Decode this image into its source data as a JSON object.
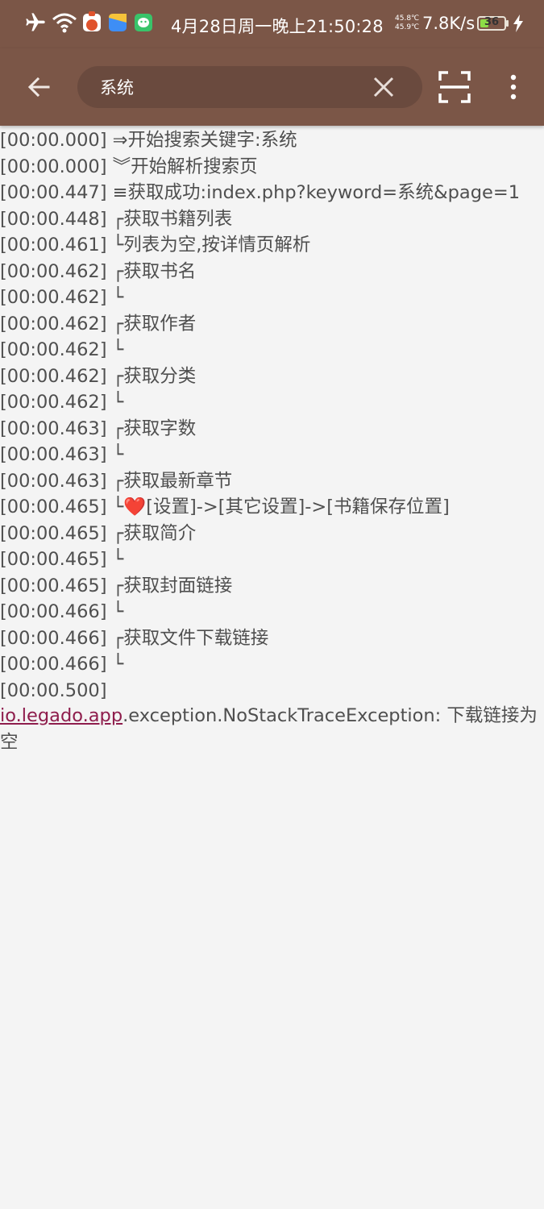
{
  "status_bar": {
    "time": "4月28日周一晚上21:50:28",
    "temp_top": "45.8℃",
    "temp_bottom": "45.9℃",
    "net_speed": "7.8K/s",
    "battery": "36",
    "battery_level": 0.36,
    "icons": [
      "airplane-icon",
      "wifi-icon",
      "app-notification-icon",
      "app-notification-icon",
      "app-notification-icon",
      "charging-icon"
    ]
  },
  "toolbar": {
    "search_value": "系统",
    "colors": {
      "bar": "#7b5647",
      "search_bg": "#6a4a3e"
    }
  },
  "log": {
    "lines": [
      {
        "ts": "[00:00.000]",
        "msg": "⇒开始搜索关键字:系统"
      },
      {
        "ts": "[00:00.000]",
        "msg": "︾开始解析搜索页"
      },
      {
        "ts": "[00:00.447]",
        "msg": "≡获取成功:index.php?keyword=系统&page=1"
      },
      {
        "ts": "[00:00.448]",
        "msg": "┌获取书籍列表"
      },
      {
        "ts": "[00:00.461]",
        "msg": "└列表为空,按详情页解析"
      },
      {
        "ts": "[00:00.462]",
        "msg": "┌获取书名"
      },
      {
        "ts": "[00:00.462]",
        "msg": "└"
      },
      {
        "ts": "[00:00.462]",
        "msg": "┌获取作者"
      },
      {
        "ts": "[00:00.462]",
        "msg": "└"
      },
      {
        "ts": "[00:00.462]",
        "msg": "┌获取分类"
      },
      {
        "ts": "[00:00.462]",
        "msg": "└"
      },
      {
        "ts": "[00:00.463]",
        "msg": "┌获取字数"
      },
      {
        "ts": "[00:00.463]",
        "msg": "└"
      },
      {
        "ts": "[00:00.463]",
        "msg": "┌获取最新章节"
      },
      {
        "ts": "[00:00.465]",
        "msg": "└❤️[设置]->[其它设置]->[书籍保存位置]"
      },
      {
        "ts": "[00:00.465]",
        "msg": "┌获取简介"
      },
      {
        "ts": "[00:00.465]",
        "msg": "└"
      },
      {
        "ts": "[00:00.465]",
        "msg": "┌获取封面链接"
      },
      {
        "ts": "[00:00.466]",
        "msg": "└"
      },
      {
        "ts": "[00:00.466]",
        "msg": "┌获取文件下载链接"
      },
      {
        "ts": "[00:00.466]",
        "msg": "└"
      },
      {
        "ts": "[00:00.500]",
        "msg": ""
      }
    ],
    "exception": {
      "link": "io.legado.app",
      "rest": ".exception.NoStackTraceException: 下载链接为空"
    }
  }
}
